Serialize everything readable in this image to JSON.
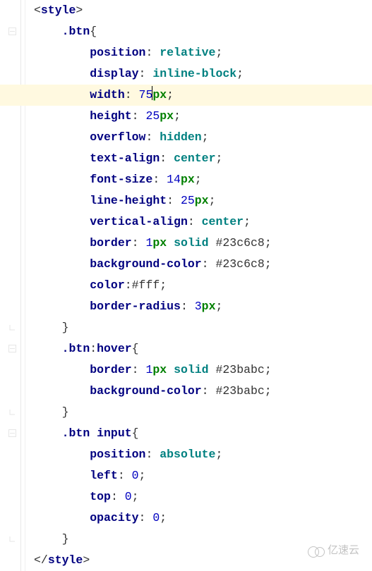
{
  "watermark": "亿速云",
  "lines": [
    {
      "indent": 0,
      "highlight": false,
      "folds": 0,
      "tokens": [
        {
          "t": "<",
          "c": "punct"
        },
        {
          "t": "style",
          "c": "tag"
        },
        {
          "t": ">",
          "c": "punct"
        }
      ]
    },
    {
      "indent": 1,
      "highlight": false,
      "folds": 1,
      "tokens": [
        {
          "t": ".btn",
          "c": "sel"
        },
        {
          "t": "{",
          "c": "punct"
        }
      ]
    },
    {
      "indent": 2,
      "highlight": false,
      "folds": 0,
      "tokens": [
        {
          "t": "position",
          "c": "prop"
        },
        {
          "t": ": ",
          "c": "punct"
        },
        {
          "t": "relative",
          "c": "val"
        },
        {
          "t": ";",
          "c": "punct"
        }
      ]
    },
    {
      "indent": 2,
      "highlight": false,
      "folds": 0,
      "tokens": [
        {
          "t": "display",
          "c": "prop"
        },
        {
          "t": ": ",
          "c": "punct"
        },
        {
          "t": "inline-block",
          "c": "val"
        },
        {
          "t": ";",
          "c": "punct"
        }
      ]
    },
    {
      "indent": 2,
      "highlight": true,
      "folds": 0,
      "cursorAfter": 2,
      "tokens": [
        {
          "t": "width",
          "c": "prop"
        },
        {
          "t": ": ",
          "c": "punct"
        },
        {
          "t": "75",
          "c": "num"
        },
        {
          "t": "px",
          "c": "unit"
        },
        {
          "t": ";",
          "c": "punct"
        }
      ]
    },
    {
      "indent": 2,
      "highlight": false,
      "folds": 0,
      "tokens": [
        {
          "t": "height",
          "c": "prop"
        },
        {
          "t": ": ",
          "c": "punct"
        },
        {
          "t": "25",
          "c": "num"
        },
        {
          "t": "px",
          "c": "unit"
        },
        {
          "t": ";",
          "c": "punct"
        }
      ]
    },
    {
      "indent": 2,
      "highlight": false,
      "folds": 0,
      "tokens": [
        {
          "t": "overflow",
          "c": "prop"
        },
        {
          "t": ": ",
          "c": "punct"
        },
        {
          "t": "hidden",
          "c": "val"
        },
        {
          "t": ";",
          "c": "punct"
        }
      ]
    },
    {
      "indent": 2,
      "highlight": false,
      "folds": 0,
      "tokens": [
        {
          "t": "text-align",
          "c": "prop"
        },
        {
          "t": ": ",
          "c": "punct"
        },
        {
          "t": "center",
          "c": "val"
        },
        {
          "t": ";",
          "c": "punct"
        }
      ]
    },
    {
      "indent": 2,
      "highlight": false,
      "folds": 0,
      "tokens": [
        {
          "t": "font-size",
          "c": "prop"
        },
        {
          "t": ": ",
          "c": "punct"
        },
        {
          "t": "14",
          "c": "num"
        },
        {
          "t": "px",
          "c": "unit"
        },
        {
          "t": ";",
          "c": "punct"
        }
      ]
    },
    {
      "indent": 2,
      "highlight": false,
      "folds": 0,
      "tokens": [
        {
          "t": "line-height",
          "c": "prop"
        },
        {
          "t": ": ",
          "c": "punct"
        },
        {
          "t": "25",
          "c": "num"
        },
        {
          "t": "px",
          "c": "unit"
        },
        {
          "t": ";",
          "c": "punct"
        }
      ]
    },
    {
      "indent": 2,
      "highlight": false,
      "folds": 0,
      "tokens": [
        {
          "t": "vertical-align",
          "c": "prop"
        },
        {
          "t": ": ",
          "c": "punct"
        },
        {
          "t": "center",
          "c": "val"
        },
        {
          "t": ";",
          "c": "punct"
        }
      ]
    },
    {
      "indent": 2,
      "highlight": false,
      "folds": 0,
      "tokens": [
        {
          "t": "border",
          "c": "prop"
        },
        {
          "t": ": ",
          "c": "punct"
        },
        {
          "t": "1",
          "c": "num"
        },
        {
          "t": "px",
          "c": "unit"
        },
        {
          "t": " ",
          "c": "punct"
        },
        {
          "t": "solid",
          "c": "val"
        },
        {
          "t": " ",
          "c": "punct"
        },
        {
          "t": "#23c6c8",
          "c": "hex"
        },
        {
          "t": ";",
          "c": "punct"
        }
      ]
    },
    {
      "indent": 2,
      "highlight": false,
      "folds": 0,
      "tokens": [
        {
          "t": "background-color",
          "c": "prop"
        },
        {
          "t": ": ",
          "c": "punct"
        },
        {
          "t": "#23c6c8",
          "c": "hex"
        },
        {
          "t": ";",
          "c": "punct"
        }
      ]
    },
    {
      "indent": 2,
      "highlight": false,
      "folds": 0,
      "tokens": [
        {
          "t": "color",
          "c": "prop"
        },
        {
          "t": ":",
          "c": "punct"
        },
        {
          "t": "#fff",
          "c": "hex"
        },
        {
          "t": ";",
          "c": "punct"
        }
      ]
    },
    {
      "indent": 2,
      "highlight": false,
      "folds": 0,
      "tokens": [
        {
          "t": "border-radius",
          "c": "prop"
        },
        {
          "t": ": ",
          "c": "punct"
        },
        {
          "t": "3",
          "c": "num"
        },
        {
          "t": "px",
          "c": "unit"
        },
        {
          "t": ";",
          "c": "punct"
        }
      ]
    },
    {
      "indent": 1,
      "highlight": false,
      "folds": 2,
      "tokens": [
        {
          "t": "}",
          "c": "punct"
        }
      ]
    },
    {
      "indent": 1,
      "highlight": false,
      "folds": 1,
      "tokens": [
        {
          "t": ".btn",
          "c": "sel"
        },
        {
          "t": ":",
          "c": "punct"
        },
        {
          "t": "hover",
          "c": "sel"
        },
        {
          "t": "{",
          "c": "punct"
        }
      ]
    },
    {
      "indent": 2,
      "highlight": false,
      "folds": 0,
      "tokens": [
        {
          "t": "border",
          "c": "prop"
        },
        {
          "t": ": ",
          "c": "punct"
        },
        {
          "t": "1",
          "c": "num"
        },
        {
          "t": "px",
          "c": "unit"
        },
        {
          "t": " ",
          "c": "punct"
        },
        {
          "t": "solid",
          "c": "val"
        },
        {
          "t": " ",
          "c": "punct"
        },
        {
          "t": "#23babc",
          "c": "hex"
        },
        {
          "t": ";",
          "c": "punct"
        }
      ]
    },
    {
      "indent": 2,
      "highlight": false,
      "folds": 0,
      "tokens": [
        {
          "t": "background-color",
          "c": "prop"
        },
        {
          "t": ": ",
          "c": "punct"
        },
        {
          "t": "#23babc",
          "c": "hex"
        },
        {
          "t": ";",
          "c": "punct"
        }
      ]
    },
    {
      "indent": 1,
      "highlight": false,
      "folds": 2,
      "tokens": [
        {
          "t": "}",
          "c": "punct"
        }
      ]
    },
    {
      "indent": 1,
      "highlight": false,
      "folds": 1,
      "tokens": [
        {
          "t": ".btn",
          "c": "sel"
        },
        {
          "t": " ",
          "c": "punct"
        },
        {
          "t": "input",
          "c": "sel"
        },
        {
          "t": "{",
          "c": "punct"
        }
      ]
    },
    {
      "indent": 2,
      "highlight": false,
      "folds": 0,
      "tokens": [
        {
          "t": "position",
          "c": "prop"
        },
        {
          "t": ": ",
          "c": "punct"
        },
        {
          "t": "absolute",
          "c": "val"
        },
        {
          "t": ";",
          "c": "punct"
        }
      ]
    },
    {
      "indent": 2,
      "highlight": false,
      "folds": 0,
      "tokens": [
        {
          "t": "left",
          "c": "prop"
        },
        {
          "t": ": ",
          "c": "punct"
        },
        {
          "t": "0",
          "c": "num"
        },
        {
          "t": ";",
          "c": "punct"
        }
      ]
    },
    {
      "indent": 2,
      "highlight": false,
      "folds": 0,
      "tokens": [
        {
          "t": "top",
          "c": "prop"
        },
        {
          "t": ": ",
          "c": "punct"
        },
        {
          "t": "0",
          "c": "num"
        },
        {
          "t": ";",
          "c": "punct"
        }
      ]
    },
    {
      "indent": 2,
      "highlight": false,
      "folds": 0,
      "tokens": [
        {
          "t": "opacity",
          "c": "prop"
        },
        {
          "t": ": ",
          "c": "punct"
        },
        {
          "t": "0",
          "c": "num"
        },
        {
          "t": ";",
          "c": "punct"
        }
      ]
    },
    {
      "indent": 1,
      "highlight": false,
      "folds": 2,
      "tokens": [
        {
          "t": "}",
          "c": "punct"
        }
      ]
    },
    {
      "indent": 0,
      "highlight": false,
      "folds": 0,
      "tokens": [
        {
          "t": "</",
          "c": "punct"
        },
        {
          "t": "style",
          "c": "tag"
        },
        {
          "t": ">",
          "c": "punct"
        }
      ]
    }
  ]
}
